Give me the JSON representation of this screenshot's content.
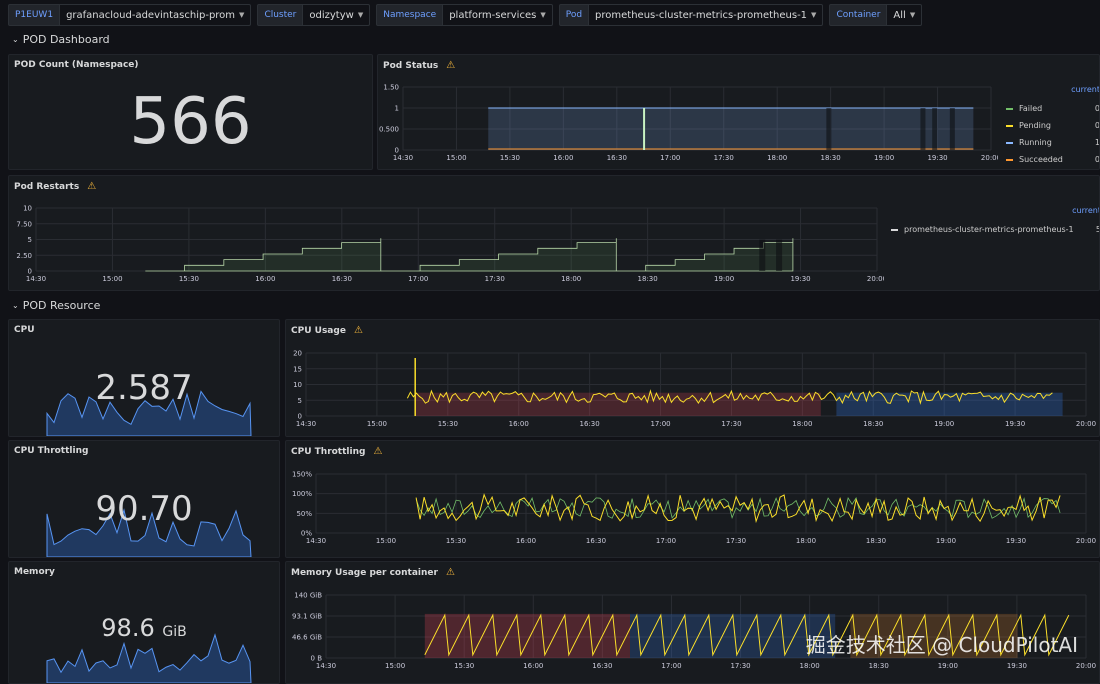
{
  "variables": [
    {
      "label": "P1EUW1",
      "value": "grafanacloud-adevintaschip-prom"
    },
    {
      "label": "Cluster",
      "value": "odizytyw"
    },
    {
      "label": "Namespace",
      "value": "platform-services"
    },
    {
      "label": "Pod",
      "value": "prometheus-cluster-metrics-prometheus-1"
    },
    {
      "label": "Container",
      "value": "All"
    }
  ],
  "rows": {
    "pod_dashboard": "POD Dashboard",
    "pod_resource": "POD Resource"
  },
  "time_ticks": [
    "14:30",
    "15:00",
    "15:30",
    "16:00",
    "16:30",
    "17:00",
    "17:30",
    "18:00",
    "18:30",
    "19:00",
    "19:30",
    "20:00"
  ],
  "panels": {
    "pod_count": {
      "title": "POD Count (Namespace)",
      "value": "566"
    },
    "pod_status": {
      "title": "Pod Status",
      "y_ticks": [
        "1.50",
        "1",
        "0.500",
        "0"
      ],
      "legend_head": "current",
      "legend": [
        {
          "name": "Failed",
          "value": "0",
          "color": "#73bf69"
        },
        {
          "name": "Pending",
          "value": "0",
          "color": "#fade2a"
        },
        {
          "name": "Running",
          "value": "1",
          "color": "#8ab8ff"
        },
        {
          "name": "Succeeded",
          "value": "0",
          "color": "#ff9830"
        }
      ]
    },
    "pod_restarts": {
      "title": "Pod Restarts",
      "y_ticks": [
        "10",
        "7.50",
        "5",
        "2.50",
        "0"
      ],
      "legend_head": "current",
      "legend": [
        {
          "name": "prometheus-cluster-metrics-prometheus-1",
          "value": "5",
          "color": "#d8d9da"
        }
      ]
    },
    "cpu": {
      "title": "CPU",
      "value": "2.587"
    },
    "cpu_usage": {
      "title": "CPU Usage",
      "y_ticks": [
        "20",
        "15",
        "10",
        "5",
        "0"
      ]
    },
    "cpu_throttling_stat": {
      "title": "CPU Throttling",
      "value": "90.70"
    },
    "cpu_throttling": {
      "title": "CPU Throttling",
      "y_ticks": [
        "150%",
        "100%",
        "50%",
        "0%"
      ]
    },
    "memory": {
      "title": "Memory",
      "value": "98.6",
      "unit": "GiB"
    },
    "memory_usage": {
      "title": "Memory Usage per container",
      "y_ticks": [
        "140 GiB",
        "93.1 GiB",
        "46.6 GiB",
        "0 B"
      ]
    }
  },
  "colors": {
    "accent": "#6e9fff",
    "warning": "#f5b73b",
    "green": "#73bf69",
    "yellow": "#fade2a",
    "blue": "#8ab8ff",
    "orange": "#ff9830",
    "red": "#f2495c"
  },
  "watermark": "掘金技术社区 @ CloudPilotAI"
}
